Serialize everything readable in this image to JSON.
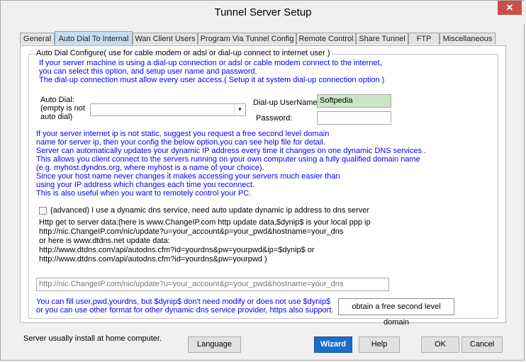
{
  "window": {
    "title": "Tunnel Server Setup",
    "close_label": "✕"
  },
  "tabs": [
    {
      "label": "General"
    },
    {
      "label": "Auto Dial To Internal"
    },
    {
      "label": "Wan Client Users"
    },
    {
      "label": "Program Via Tunnel Config"
    },
    {
      "label": "Remote Control"
    },
    {
      "label": "Share Tunnel"
    },
    {
      "label": "FTP"
    },
    {
      "label": "Miscellaneous"
    }
  ],
  "active_tab": "Auto Dial To Internal",
  "autodial": {
    "group_title": "Auto Dial Configure( use for cable modem or adsl or dial-up connect to internet user )",
    "intro_lines": [
      "If your server machine is using a dial-up connection or adsl or cable modem connect to the internet,",
      "you can select this option, and setup user name and password.",
      "The dial-up connection must allow every user access.( Setup it at system dial-up connection option )"
    ],
    "autodial_label_lines": [
      "Auto Dial:",
      "(empty is not",
      "auto dial)"
    ],
    "autodial_value": "",
    "username_label": "Dial-up UserName:",
    "username_value": "Softpedia",
    "password_label": "Password:",
    "password_value": ""
  },
  "dns_info_lines": [
    "If your server internet ip is not static, suggest you request a free second level domain",
    "name for server ip, then your config the below option,you can see help file for detail.",
    "Server can automatically updates your dynamic IP address every time it changes on one dynamic DNS services .",
    "This allows you client connect to the servers running on your own computer using a fully qualified domain name",
    "(e.g. myhost.dyndns.org, where myhost is a name of your choice).",
    "Since your host name never changes it makes accessing your servers much easier than",
    "using your IP address which changes each time you reconnect.",
    "This is also useful when you want to remotely control your PC."
  ],
  "ddns": {
    "checkbox_label": "(advanced) I use a dynamic dns service, need auto update dynamic ip address to dns server",
    "checked": false,
    "http_lines": [
      "Http get to server data:(here is www.ChangeIP.com http update data,$dynip$ is your local ppp ip",
      "http://nic.ChangeIP.com/nic/update?u=your_account&p=your_pwd&hostname=your_dns",
      "or here is www.dtdns.net update data:",
      "http://www.dtdns.com/api/autodns.cfm?id=yourdns&pw=yourpwd&ip=$dynip$ or",
      "http://www.dtdns.com/api/autodns.cfm?id=yourdns&pw=yourpwd )"
    ],
    "url_placeholder": "http://nic.ChangeIP.com/nic/update?u=your_account&p=your_pwd&hostname=your_dns",
    "note_lines": [
      "You can fill user,pwd,yourdns, but $dynip$ don't need modify or does not use $dynip$",
      "or you can use other format for other dynamic dns service provider, https also support."
    ],
    "obtain_button": "obtain a free second level domain"
  },
  "footer": {
    "status": "Server usually install at home computer.",
    "language_button": "Language",
    "wizard_button": "Wizard",
    "help_button": "Help",
    "ok_button": "OK",
    "cancel_button": "Cancel"
  }
}
